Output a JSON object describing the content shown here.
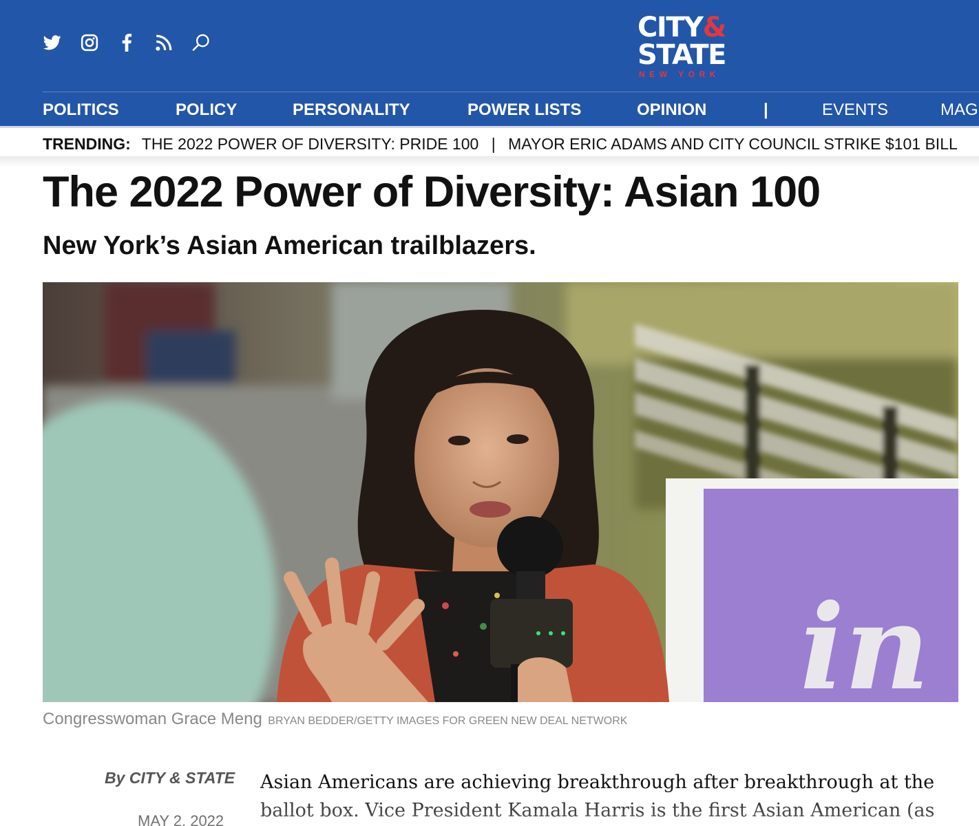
{
  "header": {
    "social_icons": [
      "twitter-icon",
      "instagram-icon",
      "facebook-icon",
      "rss-icon",
      "search-icon"
    ],
    "logo": {
      "line1": "CITY",
      "amp": "&",
      "line2": "STATE",
      "line3": "NEW YORK"
    },
    "nav": [
      "POLITICS",
      "POLICY",
      "PERSONALITY",
      "POWER LISTS",
      "OPINION",
      "|",
      "EVENTS",
      "MAG"
    ],
    "colors": {
      "brand_blue": "#2256a8",
      "brand_red": "#e2373f"
    }
  },
  "trending": {
    "label": "TRENDING:",
    "items": [
      "THE 2022 POWER OF DIVERSITY: PRIDE 100",
      "MAYOR ERIC ADAMS AND CITY COUNCIL STRIKE $101 BILL"
    ],
    "separator": "|"
  },
  "article": {
    "title": "The 2022 Power of Diversity: Asian 100",
    "subtitle": "New York’s Asian American trailblazers.",
    "caption": "Congresswoman Grace Meng",
    "photo_credit": "BRYAN BEDDER/GETTY IMAGES FOR GREEN NEW DEAL NETWORK",
    "byline": "By CITY & STATE",
    "date": "MAY 2, 2022",
    "body": "Asian Americans are achieving breakthrough after breakthrough at the ballot box. Vice President Kamala Harris is the first Asian American (as well"
  }
}
